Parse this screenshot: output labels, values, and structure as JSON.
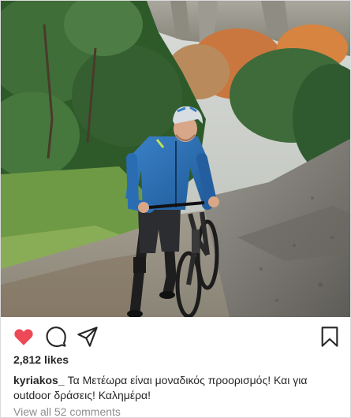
{
  "post": {
    "likes_count": "2,812",
    "likes_suffix": "likes",
    "username": "kyriakos_",
    "caption": "Τα Μετέωρα είναι μοναδικός προορισμός! Και για outdoor δράσεις! Καλημέρα!",
    "view_comments_label": "View all 52 comments",
    "liked": true
  },
  "icons": {
    "like": "heart-icon",
    "comment": "comment-bubble-icon",
    "share": "paper-plane-icon",
    "save": "bookmark-icon"
  },
  "colors": {
    "like_red": "#ed4956",
    "text": "#262626",
    "muted": "#8e8e8e",
    "jacket_blue": "#2a6db3"
  }
}
